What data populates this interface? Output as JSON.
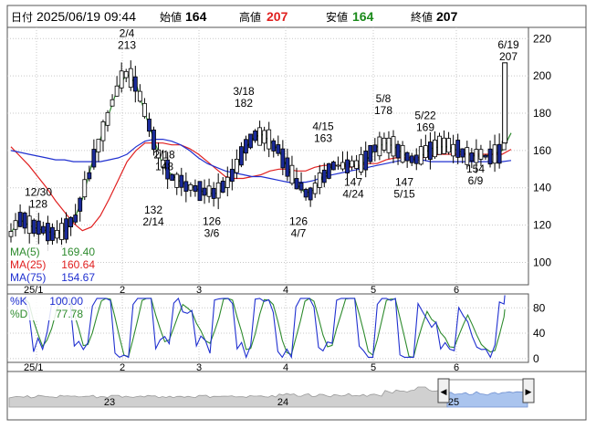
{
  "header": {
    "date_label": "日付",
    "datetime": "2025/06/19 09:44",
    "open_label": "始値",
    "open_value": "164",
    "high_label": "高値",
    "high_value": "207",
    "low_label": "安値",
    "low_value": "164",
    "close_label": "終値",
    "close_value": "207",
    "colors": {
      "high": "#e0201f",
      "low": "#1a8a1a",
      "text": "#000000"
    }
  },
  "chart_data": [
    {
      "type": "candlestick",
      "title": "",
      "y_ticks": [
        "220",
        "200",
        "180",
        "160",
        "140",
        "120",
        "100"
      ],
      "ylim": [
        88,
        226
      ],
      "x_ticks": [
        "25/1",
        "2",
        "3",
        "4",
        "5",
        "6"
      ],
      "candle_colors": {
        "up": "#ffffff",
        "down": "#1a2a9a",
        "outline": "#000000"
      },
      "annotations": [
        {
          "date": "12/30",
          "value": "128",
          "text_pos": "above"
        },
        {
          "date": "2/4",
          "value": "213",
          "text_pos": "above"
        },
        {
          "date": "2/18",
          "value": "148",
          "text_pos": "above"
        },
        {
          "date": "2/14",
          "value": "132",
          "text_pos": "below"
        },
        {
          "date": "3/6",
          "value": "126",
          "text_pos": "below"
        },
        {
          "date": "3/18",
          "value": "182",
          "text_pos": "above"
        },
        {
          "date": "4/15",
          "value": "163",
          "text_pos": "above"
        },
        {
          "date": "4/7",
          "value": "126",
          "text_pos": "below"
        },
        {
          "date": "4/24",
          "value": "147",
          "text_pos": "below"
        },
        {
          "date": "5/8",
          "value": "178",
          "text_pos": "above"
        },
        {
          "date": "5/15",
          "value": "147",
          "text_pos": "below"
        },
        {
          "date": "5/22",
          "value": "169",
          "text_pos": "above"
        },
        {
          "date": "6/9",
          "value": "154",
          "text_pos": "below"
        },
        {
          "date": "6/19",
          "value": "207",
          "text_pos": "above"
        }
      ],
      "legend": [
        {
          "name": "MA(5)",
          "value": "169.40",
          "color": "#2e8b2e"
        },
        {
          "name": "MA(25)",
          "value": "160.64",
          "color": "#e02020"
        },
        {
          "name": "MA(75)",
          "value": "154.67",
          "color": "#2030d0"
        }
      ],
      "series": [
        {
          "name": "MA(5)",
          "color": "#2e8b2e",
          "points": [
            [
              0,
              116
            ],
            [
              10,
              123
            ],
            [
              20,
              120
            ],
            [
              30,
              118
            ],
            [
              40,
              117
            ],
            [
              50,
              115
            ],
            [
              60,
              117
            ],
            [
              70,
              122
            ],
            [
              80,
              134
            ],
            [
              90,
              152
            ],
            [
              100,
              166
            ],
            [
              110,
              180
            ],
            [
              120,
              194
            ],
            [
              130,
              201
            ],
            [
              140,
              196
            ],
            [
              150,
              180
            ],
            [
              160,
              166
            ],
            [
              170,
              152
            ],
            [
              180,
              147
            ],
            [
              190,
              143
            ],
            [
              200,
              141
            ],
            [
              210,
              139
            ],
            [
              220,
              137
            ],
            [
              230,
              137
            ],
            [
              240,
              140
            ],
            [
              250,
              149
            ],
            [
              260,
              159
            ],
            [
              270,
              166
            ],
            [
              280,
              169
            ],
            [
              290,
              165
            ],
            [
              300,
              160
            ],
            [
              310,
              150
            ],
            [
              320,
              142
            ],
            [
              330,
              137
            ],
            [
              340,
              139
            ],
            [
              350,
              146
            ],
            [
              360,
              152
            ],
            [
              370,
              152
            ],
            [
              380,
              153
            ],
            [
              390,
              151
            ],
            [
              400,
              156
            ],
            [
              410,
              162
            ],
            [
              420,
              164
            ],
            [
              430,
              162
            ],
            [
              440,
              158
            ],
            [
              450,
              155
            ],
            [
              460,
              157
            ],
            [
              470,
              161
            ],
            [
              480,
              162
            ],
            [
              490,
              162
            ],
            [
              500,
              160
            ],
            [
              510,
              158
            ],
            [
              520,
              157
            ],
            [
              530,
              157
            ],
            [
              540,
              158
            ],
            [
              550,
              160
            ],
            [
              560,
              169.4
            ]
          ]
        },
        {
          "name": "MA(25)",
          "color": "#e02020",
          "points": [
            [
              0,
              162
            ],
            [
              10,
              157
            ],
            [
              20,
              152
            ],
            [
              30,
              146
            ],
            [
              40,
              140
            ],
            [
              50,
              133
            ],
            [
              60,
              127
            ],
            [
              70,
              121
            ],
            [
              80,
              117
            ],
            [
              90,
              119
            ],
            [
              100,
              125
            ],
            [
              110,
              134
            ],
            [
              120,
              144
            ],
            [
              130,
              154
            ],
            [
              140,
              160
            ],
            [
              150,
              164
            ],
            [
              160,
              164
            ],
            [
              170,
              164
            ],
            [
              180,
              163
            ],
            [
              190,
              163
            ],
            [
              200,
              161
            ],
            [
              210,
              158
            ],
            [
              220,
              154
            ],
            [
              230,
              150
            ],
            [
              240,
              146
            ],
            [
              250,
              145
            ],
            [
              260,
              145
            ],
            [
              270,
              146
            ],
            [
              280,
              147
            ],
            [
              290,
              149
            ],
            [
              300,
              150
            ],
            [
              310,
              150
            ],
            [
              320,
              149
            ],
            [
              330,
              149
            ],
            [
              340,
              151
            ],
            [
              350,
              152
            ],
            [
              360,
              152
            ],
            [
              370,
              152
            ],
            [
              380,
              151
            ],
            [
              390,
              152
            ],
            [
              400,
              153
            ],
            [
              410,
              153
            ],
            [
              420,
              155
            ],
            [
              430,
              156
            ],
            [
              440,
              156
            ],
            [
              450,
              156
            ],
            [
              460,
              156
            ],
            [
              470,
              157
            ],
            [
              480,
              158
            ],
            [
              490,
              158
            ],
            [
              500,
              158
            ],
            [
              510,
              158
            ],
            [
              520,
              158
            ],
            [
              530,
              158
            ],
            [
              540,
              158
            ],
            [
              550,
              158
            ],
            [
              560,
              160.64
            ]
          ]
        },
        {
          "name": "MA(75)",
          "color": "#2030d0",
          "points": [
            [
              0,
              160
            ],
            [
              10,
              159
            ],
            [
              20,
              158
            ],
            [
              30,
              157
            ],
            [
              40,
              156
            ],
            [
              50,
              155
            ],
            [
              60,
              155
            ],
            [
              70,
              154
            ],
            [
              80,
              154
            ],
            [
              90,
              154
            ],
            [
              100,
              154
            ],
            [
              110,
              155
            ],
            [
              120,
              156
            ],
            [
              130,
              158
            ],
            [
              140,
              162
            ],
            [
              150,
              165
            ],
            [
              160,
              166
            ],
            [
              170,
              166
            ],
            [
              180,
              165
            ],
            [
              190,
              163
            ],
            [
              200,
              160
            ],
            [
              210,
              156
            ],
            [
              220,
              153
            ],
            [
              230,
              151
            ],
            [
              240,
              149
            ],
            [
              250,
              148
            ],
            [
              260,
              147
            ],
            [
              270,
              146
            ],
            [
              280,
              146
            ],
            [
              290,
              145
            ],
            [
              300,
              144
            ],
            [
              310,
              143
            ],
            [
              320,
              143
            ],
            [
              330,
              143
            ],
            [
              340,
              144
            ],
            [
              350,
              146
            ],
            [
              360,
              147
            ],
            [
              370,
              148
            ],
            [
              380,
              149
            ],
            [
              390,
              150
            ],
            [
              400,
              151
            ],
            [
              410,
              152
            ],
            [
              420,
              153
            ],
            [
              430,
              154
            ],
            [
              440,
              155
            ],
            [
              450,
              155
            ],
            [
              460,
              155
            ],
            [
              470,
              154
            ],
            [
              480,
              154
            ],
            [
              490,
              154
            ],
            [
              500,
              154
            ],
            [
              510,
              154
            ],
            [
              520,
              154
            ],
            [
              530,
              154
            ],
            [
              540,
              154
            ],
            [
              550,
              154
            ],
            [
              560,
              154.67
            ]
          ]
        }
      ]
    },
    {
      "type": "line",
      "title": "",
      "y_ticks": [
        "80",
        "40",
        "0"
      ],
      "ylim": [
        -6,
        102
      ],
      "x_ticks": [
        "25/1",
        "2",
        "3",
        "4",
        "5",
        "6"
      ],
      "legend": [
        {
          "name": "%K",
          "value": "100.00",
          "color": "#2030d0"
        },
        {
          "name": "%D",
          "value": "77.78",
          "color": "#2e8b2e"
        }
      ]
    },
    {
      "type": "area",
      "title": "",
      "x_ticks": [
        "23",
        "24",
        "25"
      ],
      "colors": {
        "history": "#d0d0d0",
        "selected": "#aac4ee"
      }
    }
  ]
}
